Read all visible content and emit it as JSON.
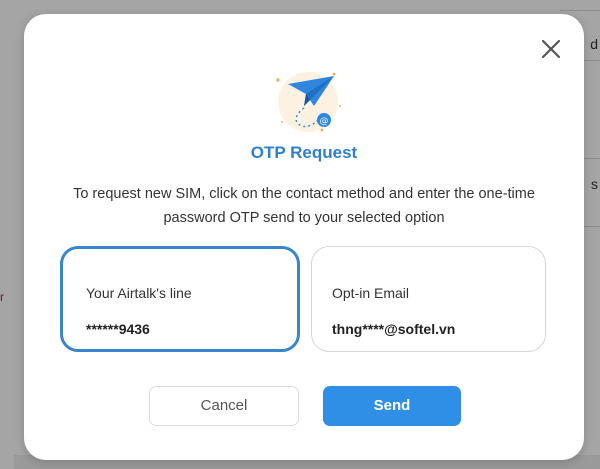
{
  "background": {
    "right_text_1": "d",
    "right_text_2": "s",
    "left_mark": "r"
  },
  "dialog": {
    "title": "OTP Request",
    "description": "To request new SIM, click on the contact method and enter the one-time password OTP send to your selected option",
    "options": [
      {
        "label": "Your Airtalk's line",
        "value": "******9436",
        "selected": true
      },
      {
        "label": "Opt-in Email",
        "value": "thng****@softel.vn",
        "selected": false
      }
    ],
    "cancel_label": "Cancel",
    "send_label": "Send",
    "close_icon": "close-icon",
    "illustration_icon": "paper-plane-email-icon"
  },
  "colors": {
    "accent": "#2f8fe6",
    "title": "#2f7fd0",
    "selected_border": "#3a86cc"
  }
}
